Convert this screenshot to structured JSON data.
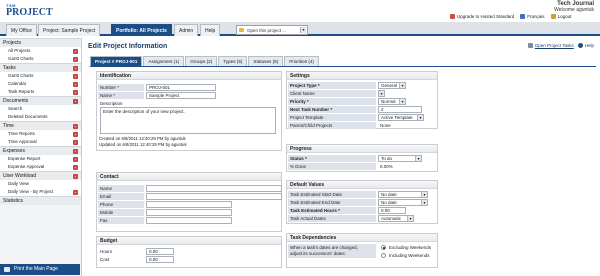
{
  "header": {
    "logo_top": "TSM",
    "logo_text": "PROJECT",
    "journal": "Tech Journal",
    "welcome": "Welcome aguntuk",
    "links": [
      "Upgrade to Hosted Standard",
      "Français",
      "Logout"
    ]
  },
  "nav": {
    "tabs": [
      "My Office",
      "Project: Sample Project",
      "Portfolio: All Projects",
      "Admin",
      "Help"
    ],
    "open_placeholder": "Open this project ..."
  },
  "sidebar": {
    "sections": [
      {
        "label": "Projects",
        "items": [
          "All Projects",
          "Gantt Charts"
        ]
      },
      {
        "label": "Tasks",
        "items": [
          "Gantt Charts",
          "Calendar",
          "Task Reports"
        ]
      },
      {
        "label": "Documents",
        "items": [
          "Search",
          "Deleted Documents"
        ]
      },
      {
        "label": "Time",
        "items": [
          "Time Reports",
          "Time Approval"
        ]
      },
      {
        "label": "Expenses",
        "items": [
          "Expense Report",
          "Expense Approval"
        ]
      },
      {
        "label": "User Workload",
        "items": [
          "Daily View",
          "Daily View - By Project"
        ]
      },
      {
        "label": "Statistics",
        "items": []
      }
    ],
    "print_label": "Print the Main Page"
  },
  "main": {
    "title": "Edit Project Information",
    "open_project_tasks": "Open Project Tasks",
    "help": "Help",
    "tabs": [
      "Project # PROJ-001",
      "Assignment (1)",
      "Groups (2)",
      "Types (5)",
      "Statuses (5)",
      "Priorities (4)"
    ],
    "identification": {
      "title": "Identification",
      "number_label": "Number *",
      "number_value": "PROJ-001",
      "name_label": "Name *",
      "name_value": "Sample Project",
      "desc_label": "Description",
      "desc_value": "Enter the description of your new project.",
      "created": "Created on 6/8/2011 12:40:29 PM by aguntuk",
      "updated": "Updated on 6/8/2011 12:40:29 PM by aguntuk"
    },
    "contact": {
      "title": "Contact",
      "fields": [
        "Name",
        "Email",
        "Phone",
        "Mobile",
        "Fax"
      ]
    },
    "budget": {
      "title": "Budget",
      "hours_label": "Hours",
      "hours_value": "0.00",
      "cost_label": "Cost",
      "cost_value": "0.00"
    },
    "settings": {
      "title": "Settings",
      "rows": [
        {
          "label": "Project Type *",
          "value": "General"
        },
        {
          "label": "Client Name",
          "value": ""
        },
        {
          "label": "Priority *",
          "value": "Normal"
        },
        {
          "label": "Next Task Number *",
          "value": "2"
        },
        {
          "label": "Project Template",
          "value": "Active Template"
        },
        {
          "label": "Parent/Child Projects",
          "value": "None"
        }
      ]
    },
    "progress": {
      "title": "Progress",
      "status_label": "Status *",
      "status_value": "To do",
      "done_label": "% Done",
      "done_value": "0.00%"
    },
    "defaults": {
      "title": "Default Values",
      "rows": [
        {
          "label": "Task Estimated Start Date",
          "value": "No date"
        },
        {
          "label": "Task Estimated End Date",
          "value": "No date"
        },
        {
          "label": "Task Estimated Hours *",
          "value": "0.00"
        },
        {
          "label": "Task Actual Dates",
          "value": "Automatic"
        }
      ]
    },
    "dependencies": {
      "title": "Task Dependencies",
      "note_line1": "When a task's dates are changed,",
      "note_line2": "adjust its successors' dates:",
      "option1": "Excluding Weekends",
      "option2": "Including Weekends"
    }
  }
}
